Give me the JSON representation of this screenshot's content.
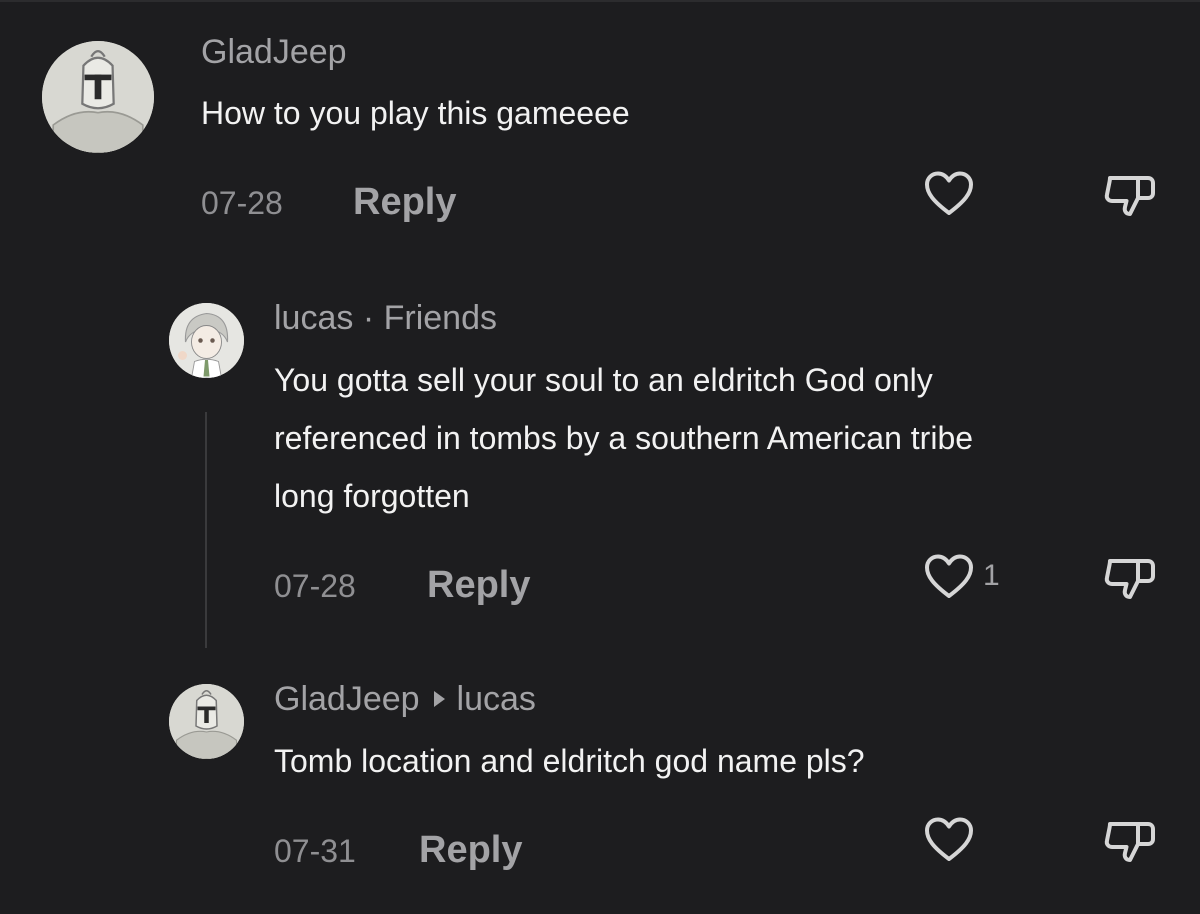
{
  "comments": [
    {
      "username": "GladJeep",
      "text": "How to you play this gameeee",
      "date": "07-28",
      "reply_label": "Reply"
    },
    {
      "username": "lucas",
      "separator": "·",
      "relation": "Friends",
      "text_lines": [
        "You gotta sell your soul to an eldritch God only",
        "referenced in tombs by a southern American tribe",
        "long forgotten"
      ],
      "date": "07-28",
      "reply_label": "Reply",
      "like_count": "1"
    },
    {
      "username": "GladJeep",
      "reply_to": "lucas",
      "text": "Tomb location and eldritch god name pls?",
      "date": "07-31",
      "reply_label": "Reply"
    }
  ],
  "icons": {
    "avatar": "avatar",
    "like": "heart-icon",
    "dislike": "thumbs-down-icon",
    "reply_arrow": "reply-arrow-icon"
  },
  "colors": {
    "background": "#1d1d1f",
    "text": "#f2f2f2",
    "muted": "#a3a3a6"
  }
}
